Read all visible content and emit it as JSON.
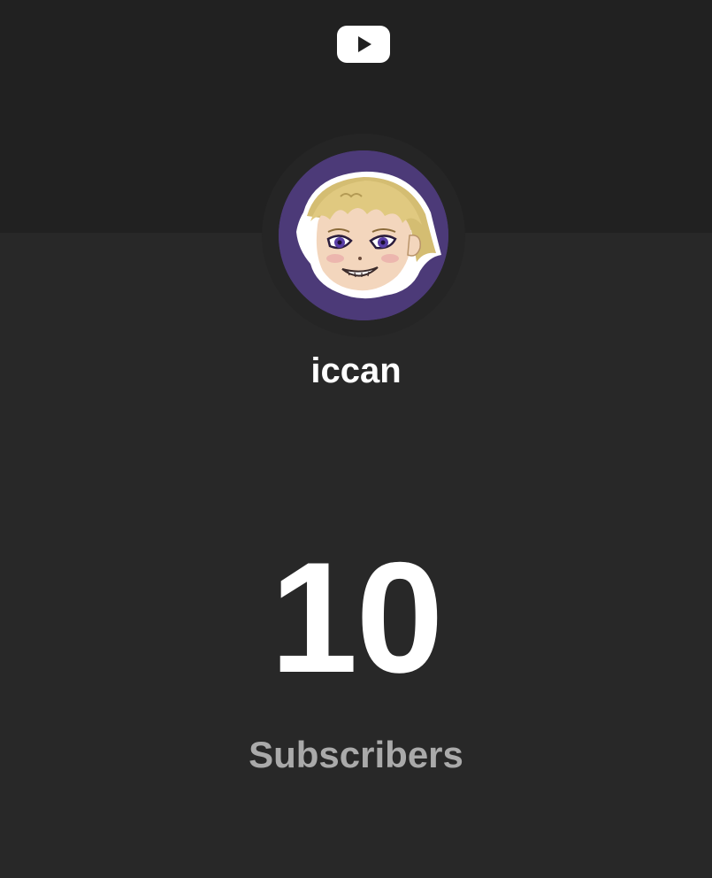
{
  "header": {
    "logo_icon": "youtube-play-icon",
    "logo_color": "#ffffff"
  },
  "channel": {
    "name": "iccan",
    "avatar_icon": "anime-character-avatar",
    "avatar_bg": "#4c3a78"
  },
  "stats": {
    "subscriber_count": "10",
    "subscriber_label": "Subscribers"
  },
  "colors": {
    "top_background": "#212121",
    "main_background": "#282828",
    "label_gray": "#aaaaaa"
  }
}
